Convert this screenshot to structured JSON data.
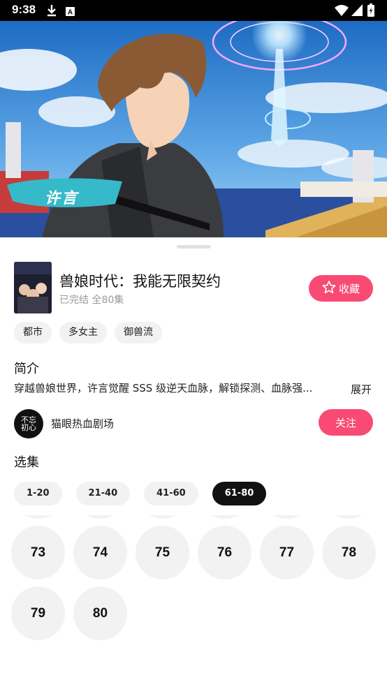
{
  "status_bar": {
    "time": "9:38",
    "icons": [
      "download-icon",
      "a-notification-icon",
      "wifi-icon",
      "signal-icon",
      "battery-icon"
    ]
  },
  "banner": {
    "character_name": "许言"
  },
  "drama": {
    "title": "兽娘时代：我能无限契约",
    "status": "已完结 全80集",
    "favorite_label": "收藏",
    "tags": [
      "都市",
      "多女主",
      "御兽流"
    ]
  },
  "intro": {
    "heading": "简介",
    "text": "穿越兽娘世界，许言觉醒 SSS 级逆天血脉，解锁探测、血脉强...",
    "expand_label": "展开"
  },
  "author": {
    "avatar_text": "不忘初心",
    "name": "猫眼热血剧场",
    "follow_label": "关注"
  },
  "episodes": {
    "heading": "选集",
    "ranges": [
      {
        "label": "1-20",
        "active": false
      },
      {
        "label": "21-40",
        "active": false
      },
      {
        "label": "41-60",
        "active": false
      },
      {
        "label": "61-80",
        "active": true
      }
    ],
    "visible": [
      "73",
      "74",
      "75",
      "76",
      "77",
      "78",
      "79",
      "80"
    ]
  },
  "colors": {
    "accent": "#f94a73",
    "chip_bg": "#f2f2f2",
    "active_range": "#111111"
  }
}
